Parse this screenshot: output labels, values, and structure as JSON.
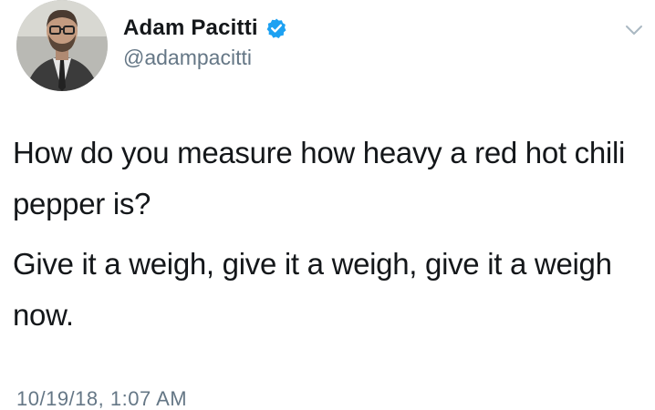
{
  "tweet": {
    "author": {
      "display_name": "Adam Pacitti",
      "handle": "@adampacitti",
      "verified": true,
      "avatar_icon": "profile-photo"
    },
    "menu_icon": "chevron-down-icon",
    "text_paragraphs": [
      "How do you measure how heavy a red hot chili pepper is?",
      "Give it a weigh, give it a weigh, give it a weigh now."
    ],
    "timestamp": "10/19/18, 1:07 AM"
  },
  "colors": {
    "text_primary": "#14171a",
    "text_secondary": "#657786",
    "verified_blue": "#1da1f2",
    "background": "#ffffff"
  }
}
